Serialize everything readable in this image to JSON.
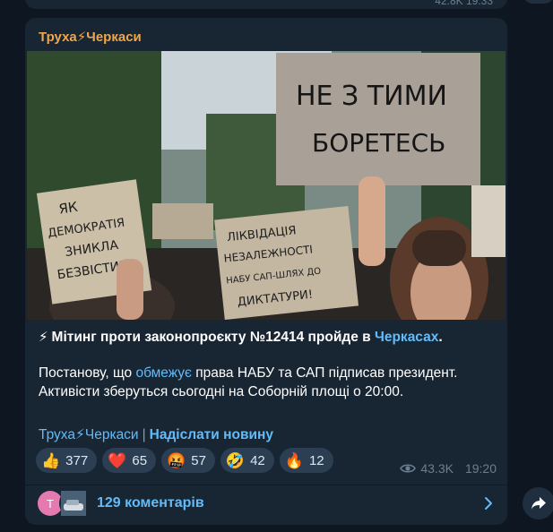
{
  "previous_message": {
    "meta": "42.8K 19:33"
  },
  "post": {
    "channel_name": "Труха⚡Черкаси",
    "headline": {
      "prefix": "Мітинг проти законопроєкту №12414 пройде в ",
      "link": "Черкасах",
      "suffix": "."
    },
    "body": {
      "prefix": "Постанову, що ",
      "link": "обмежує",
      "suffix": " права НАБУ та САП підписав президент.",
      "line2": "Активісти зберуться сьогодні на Соборній площі о 20:00."
    },
    "photo_signs": {
      "sign1_line1": "НЕ З ТИМИ",
      "sign1_line2": "БОРЕТЕСЬ",
      "sign2_line1": "ЯК",
      "sign2_line2": "ДЕМОКРАТІЯ",
      "sign2_line3": "ЗНИКЛА",
      "sign2_line4": "БЕЗВІСТИ?",
      "sign3_line1": "ЛІКВІДАЦІЯ",
      "sign3_line2": "НЕЗАЛЕЖНОСТІ",
      "sign3_line3": "НАБУ САП-ШЛЯХ ДО",
      "sign3_line4": "ДИКТАТУРИ!"
    },
    "footer": {
      "channel_link": "Труха⚡Черкаси",
      "separator": "|",
      "submit_link": "Надіслати новину"
    },
    "reactions": [
      {
        "emoji": "👍",
        "count": "377"
      },
      {
        "emoji": "❤️",
        "count": "65"
      },
      {
        "emoji": "🤬",
        "count": "57"
      },
      {
        "emoji": "🤣",
        "count": "42"
      },
      {
        "emoji": "🔥",
        "count": "12"
      }
    ],
    "views": "43.3K",
    "time": "19:20",
    "comments": {
      "avatar_letter": "T",
      "label": "129 коментарів"
    }
  },
  "icons": {
    "eye": "eye-icon",
    "chevron": "chevron-right-icon",
    "share": "share-icon",
    "lightning": "lightning-icon"
  },
  "colors": {
    "background": "#0e1621",
    "bubble": "#182533",
    "accent_link": "#62bcf9",
    "channel_name": "#f0a64a",
    "meta": "#6d7f8f"
  }
}
